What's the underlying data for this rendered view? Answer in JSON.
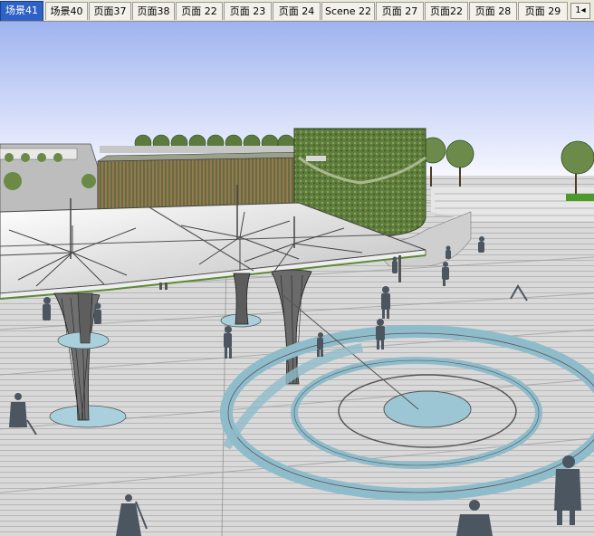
{
  "scene_tabs": [
    {
      "label": "场景41",
      "active": true
    },
    {
      "label": "场景40",
      "active": false
    },
    {
      "label": "页面37",
      "active": false
    },
    {
      "label": "页面38",
      "active": false
    },
    {
      "label": "页面 22",
      "active": false
    },
    {
      "label": "页面 23",
      "active": false
    },
    {
      "label": "页面 24",
      "active": false
    },
    {
      "label": "Scene 22",
      "active": false
    },
    {
      "label": "页面 27",
      "active": false
    },
    {
      "label": "页面22",
      "active": false
    },
    {
      "label": "页面 28",
      "active": false
    },
    {
      "label": "页面 29",
      "active": false
    }
  ],
  "tab_scroll": {
    "label": "1◂",
    "icon": "scroll-left-icon"
  },
  "colors": {
    "active_tab": "#2e62c7",
    "sky_top": "#9fb4f0",
    "sky_bottom": "#f6f7ff",
    "pavement": "#d8d8d8",
    "water_ring": "#9cc6d3",
    "hedge": "#5e7a3c",
    "canopy": "#f1f1f1"
  }
}
